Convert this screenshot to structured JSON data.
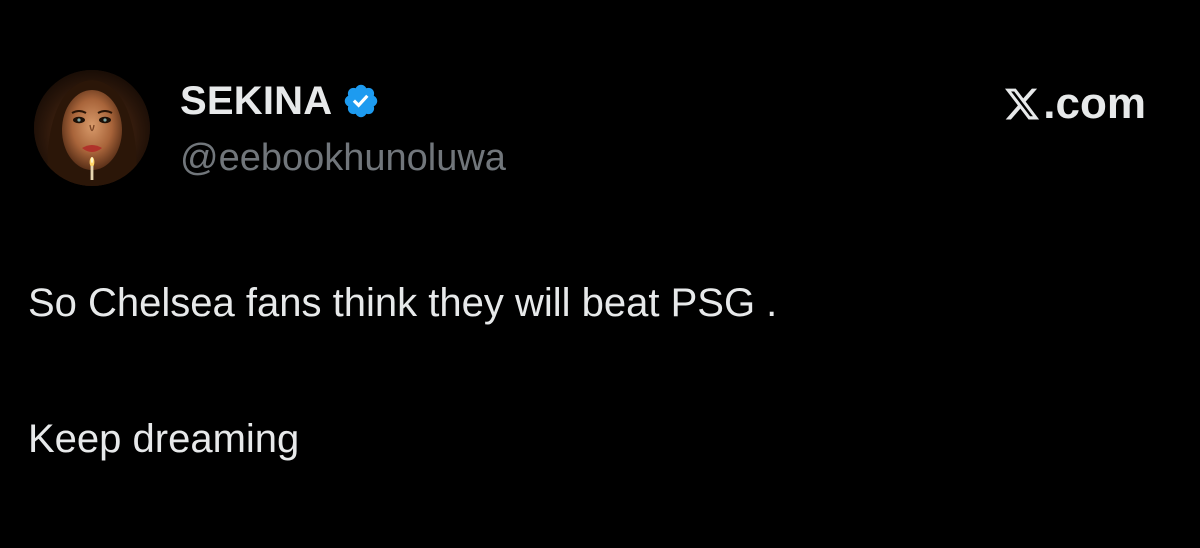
{
  "author": {
    "display_name": "SEKINA",
    "handle": "@eebookhunoluwa",
    "verified": true,
    "avatar_icon": "avatar-portrait",
    "verified_badge_color": "#1d9bf0"
  },
  "brand": {
    "logo_icon": "x-logo-icon",
    "text": ".com"
  },
  "tweet": {
    "lines": [
      "So Chelsea fans think they will beat PSG .",
      "Keep dreaming"
    ]
  },
  "colors": {
    "background": "#000000",
    "text_primary": "#e7e9ea",
    "text_secondary": "#71767b"
  }
}
